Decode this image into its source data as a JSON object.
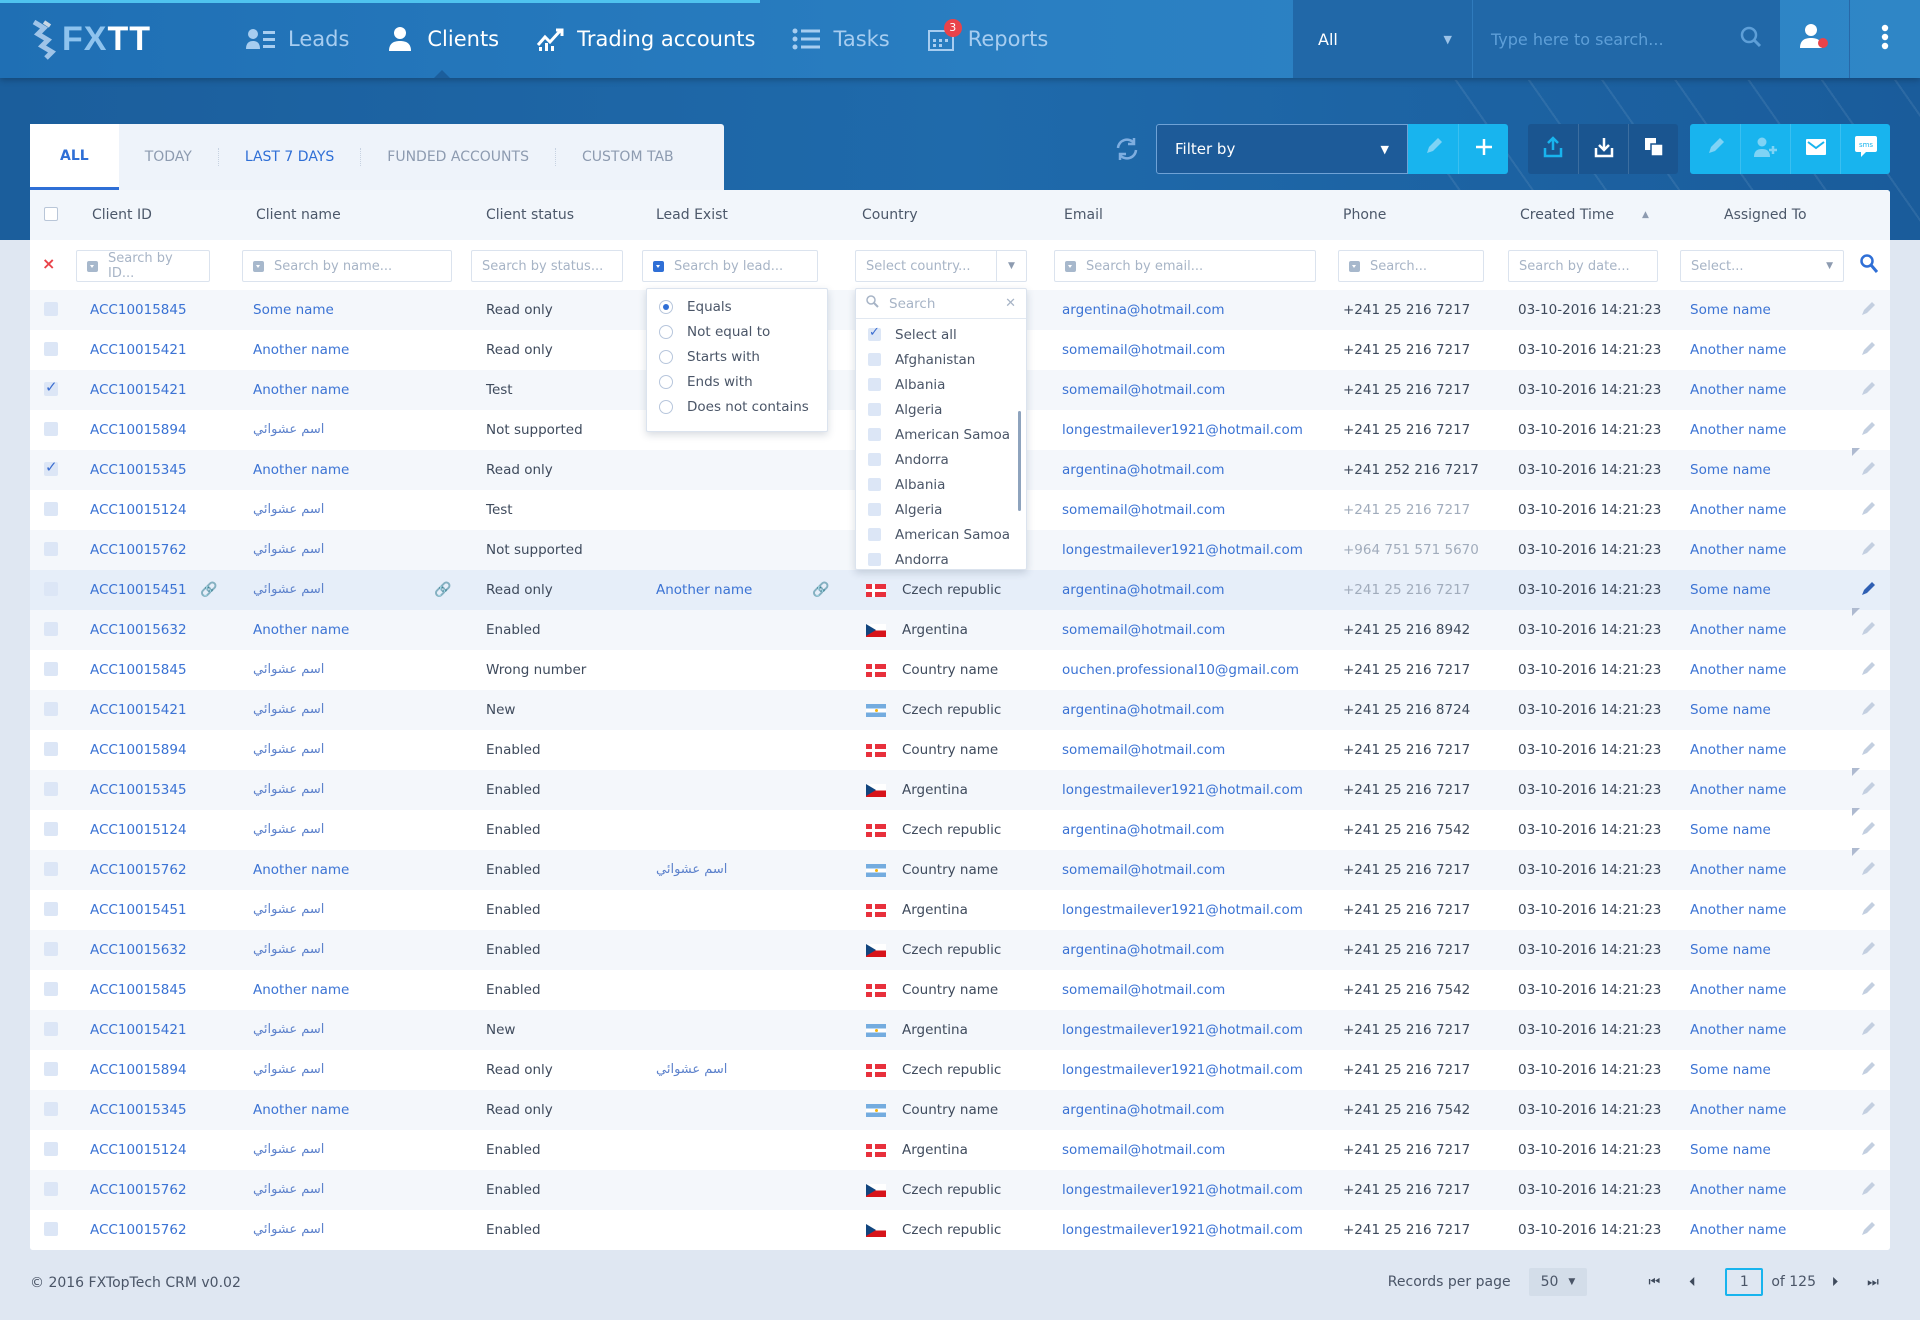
{
  "app": {
    "logo": "FXTT",
    "logo_prefix": "FX",
    "logo_suffix": "TT"
  },
  "nav": {
    "items": [
      {
        "label": "Leads",
        "icon": "leads-icon"
      },
      {
        "label": "Clients",
        "icon": "user-icon",
        "active": true
      },
      {
        "label": "Trading accounts",
        "icon": "chart-icon"
      },
      {
        "label": "Tasks",
        "icon": "list-icon"
      },
      {
        "label": "Reports",
        "icon": "calendar-icon",
        "badge": "3"
      }
    ]
  },
  "global_search": {
    "scope": "All",
    "placeholder": "Type here to search..."
  },
  "tabs": [
    {
      "label": "ALL",
      "active": true
    },
    {
      "label": "TODAY"
    },
    {
      "label": "LAST 7 DAYS"
    },
    {
      "label": "FUNDED ACCOUNTS"
    },
    {
      "label": "CUSTOM TAB"
    }
  ],
  "toolbar": {
    "filter_placeholder": "Filter by"
  },
  "table": {
    "columns": [
      "Client ID",
      "Client name",
      "Client status",
      "Lead Exist",
      "Country",
      "Email",
      "Phone",
      "Created Time",
      "Assigned To"
    ],
    "filters": {
      "id": "Search by ID...",
      "name": "Search by name...",
      "status": "Search by status...",
      "lead": "Search by lead...",
      "country": "Select country...",
      "email": "Search by email...",
      "phone": "Search...",
      "date": "Search by date...",
      "assigned": "Select..."
    },
    "rows": [
      {
        "id": "ACC10015845",
        "name": "Some name",
        "status": "Read only",
        "lead": "",
        "flag": "",
        "country": "",
        "email": "argentina@hotmail.com",
        "phone": "+241 25 216 7217",
        "created": "03-10-2016 14:21:23",
        "assigned": "Some name",
        "checked": false
      },
      {
        "id": "ACC10015421",
        "name": "Another name",
        "status": "Read only",
        "lead": "",
        "flag": "",
        "country": "",
        "email": "somemail@hotmail.com",
        "phone": "+241 25 216 7217",
        "created": "03-10-2016 14:21:23",
        "assigned": "Another name",
        "checked": false
      },
      {
        "id": "ACC10015421",
        "name": "Another name",
        "status": "Test",
        "lead": "",
        "flag": "",
        "country": "",
        "email": "somemail@hotmail.com",
        "phone": "+241 25 216 7217",
        "created": "03-10-2016 14:21:23",
        "assigned": "Another name",
        "checked": true
      },
      {
        "id": "ACC10015894",
        "name": "اسم عشوائي",
        "status": "Not supported",
        "lead": "",
        "flag": "",
        "country": "",
        "email": "longestmailever1921@hotmail.com",
        "phone": "+241 25 216 7217",
        "created": "03-10-2016 14:21:23",
        "assigned": "Another name",
        "checked": false
      },
      {
        "id": "ACC10015345",
        "name": "Another name",
        "status": "Read only",
        "lead": "",
        "flag": "",
        "country": "",
        "email": "argentina@hotmail.com",
        "phone": "+241 252 216 7217",
        "created": "03-10-2016 14:21:23",
        "assigned": "Some name",
        "checked": true
      },
      {
        "id": "ACC10015124",
        "name": "اسم عشوائي",
        "status": "Test",
        "lead": "",
        "flag": "",
        "country": "",
        "email": "somemail@hotmail.com",
        "phone": "+241 25 216 7217",
        "phone_muted": true,
        "created": "03-10-2016 14:21:23",
        "assigned": "Another name",
        "checked": false
      },
      {
        "id": "ACC10015762",
        "name": "اسم عشوائي",
        "status": "Not supported",
        "lead": "",
        "flag": "",
        "country": "",
        "email": "longestmailever1921@hotmail.com",
        "phone": "+964 751 571 5670",
        "phone_muted": true,
        "created": "03-10-2016 14:21:23",
        "assigned": "Another name",
        "checked": false
      },
      {
        "id": "ACC10015451",
        "name": "اسم عشوائي",
        "status": "Read only",
        "lead": "Another name",
        "flag": "dk",
        "country": "Czech republic",
        "email": "argentina@hotmail.com",
        "phone": "+241 25 216 7217",
        "phone_muted": true,
        "created": "03-10-2016 14:21:23",
        "assigned": "Some name",
        "checked": false,
        "hover": true
      },
      {
        "id": "ACC10015632",
        "name": "Another name",
        "status": "Enabled",
        "lead": "",
        "flag": "cz",
        "country": "Argentina",
        "email": "somemail@hotmail.com",
        "phone": "+241 25 216 8942",
        "created": "03-10-2016 14:21:23",
        "assigned": "Another name",
        "checked": false
      },
      {
        "id": "ACC10015845",
        "name": "اسم عشوائي",
        "status": "Wrong number",
        "lead": "",
        "flag": "dk",
        "country": "Country name",
        "email": "ouchen.professional10@gmail.com",
        "phone": "+241 25 216 7217",
        "created": "03-10-2016 14:21:23",
        "assigned": "Another name",
        "checked": false
      },
      {
        "id": "ACC10015421",
        "name": "اسم عشوائي",
        "status": "New",
        "lead": "",
        "flag": "ar",
        "country": "Czech republic",
        "email": "argentina@hotmail.com",
        "phone": "+241 25 216 8724",
        "created": "03-10-2016 14:21:23",
        "assigned": "Some name",
        "checked": false
      },
      {
        "id": "ACC10015894",
        "name": "اسم عشوائي",
        "status": "Enabled",
        "lead": "",
        "flag": "dk",
        "country": "Country name",
        "email": "somemail@hotmail.com",
        "phone": "+241 25 216 7217",
        "created": "03-10-2016 14:21:23",
        "assigned": "Another name",
        "checked": false
      },
      {
        "id": "ACC10015345",
        "name": "اسم عشوائي",
        "status": "Enabled",
        "lead": "",
        "flag": "cz",
        "country": "Argentina",
        "email": "longestmailever1921@hotmail.com",
        "phone": "+241 25 216 7217",
        "created": "03-10-2016 14:21:23",
        "assigned": "Another name",
        "checked": false
      },
      {
        "id": "ACC10015124",
        "name": "اسم عشوائي",
        "status": "Enabled",
        "lead": "",
        "flag": "dk",
        "country": "Czech republic",
        "email": "argentina@hotmail.com",
        "phone": "+241 25 216 7542",
        "created": "03-10-2016 14:21:23",
        "assigned": "Some name",
        "checked": false
      },
      {
        "id": "ACC10015762",
        "name": "Another name",
        "status": "Enabled",
        "lead": "اسم عشوائي",
        "flag": "ar",
        "country": "Country name",
        "email": "somemail@hotmail.com",
        "phone": "+241 25 216 7217",
        "created": "03-10-2016 14:21:23",
        "assigned": "Another name",
        "checked": false
      },
      {
        "id": "ACC10015451",
        "name": "اسم عشوائي",
        "status": "Enabled",
        "lead": "",
        "flag": "dk",
        "country": "Argentina",
        "email": "longestmailever1921@hotmail.com",
        "phone": "+241 25 216 7217",
        "created": "03-10-2016 14:21:23",
        "assigned": "Another name",
        "checked": false
      },
      {
        "id": "ACC10015632",
        "name": "اسم عشوائي",
        "status": "Enabled",
        "lead": "",
        "flag": "cz",
        "country": "Czech republic",
        "email": "argentina@hotmail.com",
        "phone": "+241 25 216 7217",
        "created": "03-10-2016 14:21:23",
        "assigned": "Some name",
        "checked": false
      },
      {
        "id": "ACC10015845",
        "name": "Another name",
        "status": "Enabled",
        "lead": "",
        "flag": "dk",
        "country": "Country name",
        "email": "somemail@hotmail.com",
        "phone": "+241 25 216 7542",
        "created": "03-10-2016 14:21:23",
        "assigned": "Another name",
        "checked": false
      },
      {
        "id": "ACC10015421",
        "name": "اسم عشوائي",
        "status": "New",
        "lead": "",
        "flag": "ar",
        "country": "Argentina",
        "email": "longestmailever1921@hotmail.com",
        "phone": "+241 25 216 7217",
        "created": "03-10-2016 14:21:23",
        "assigned": "Another name",
        "checked": false
      },
      {
        "id": "ACC10015894",
        "name": "اسم عشوائي",
        "status": "Read only",
        "lead": "اسم عشوائي",
        "flag": "dk",
        "country": "Czech republic",
        "email": "longestmailever1921@hotmail.com",
        "phone": "+241 25 216 7217",
        "created": "03-10-2016 14:21:23",
        "assigned": "Some name",
        "checked": false
      },
      {
        "id": "ACC10015345",
        "name": "Another name",
        "status": "Read only",
        "lead": "",
        "flag": "ar",
        "country": "Country name",
        "email": "argentina@hotmail.com",
        "phone": "+241 25 216 7542",
        "created": "03-10-2016 14:21:23",
        "assigned": "Another name",
        "checked": false
      },
      {
        "id": "ACC10015124",
        "name": "اسم عشوائي",
        "status": "Enabled",
        "lead": "",
        "flag": "dk",
        "country": "Argentina",
        "email": "somemail@hotmail.com",
        "phone": "+241 25 216 7217",
        "created": "03-10-2016 14:21:23",
        "assigned": "Some name",
        "checked": false
      },
      {
        "id": "ACC10015762",
        "name": "اسم عشوائي",
        "status": "Enabled",
        "lead": "",
        "flag": "cz",
        "country": "Czech republic",
        "email": "longestmailever1921@hotmail.com",
        "phone": "+241 25 216 7217",
        "created": "03-10-2016 14:21:23",
        "assigned": "Another name",
        "checked": false
      },
      {
        "id": "ACC10015762",
        "name": "اسم عشوائي",
        "status": "Enabled",
        "lead": "",
        "flag": "cz",
        "country": "Czech republic",
        "email": "longestmailever1921@hotmail.com",
        "phone": "+241 25 216 7217",
        "created": "03-10-2016 14:21:23",
        "assigned": "Another name",
        "checked": false
      }
    ]
  },
  "lead_filter_dropdown": {
    "options": [
      {
        "label": "Equals",
        "selected": true
      },
      {
        "label": "Not equal to"
      },
      {
        "label": "Starts with"
      },
      {
        "label": "Ends with"
      },
      {
        "label": "Does not contains"
      }
    ]
  },
  "country_dropdown": {
    "search_placeholder": "Search",
    "select_all": "Select all",
    "options": [
      "Afghanistan",
      "Albania",
      "Algeria",
      "American Samoa",
      "Andorra",
      "Albania",
      "Algeria",
      "American Samoa",
      "Andorra"
    ]
  },
  "footer": {
    "copyright": "© 2016 FXTopTech CRM v0.02",
    "records_per_page_label": "Records per page",
    "records_per_page": "50",
    "current_page": "1",
    "total_pages_label": "of 125"
  },
  "colors": {
    "brand": "#1f6fb4",
    "accent": "#18b4ee",
    "link": "#3b73d4",
    "badge": "#e9434a"
  }
}
